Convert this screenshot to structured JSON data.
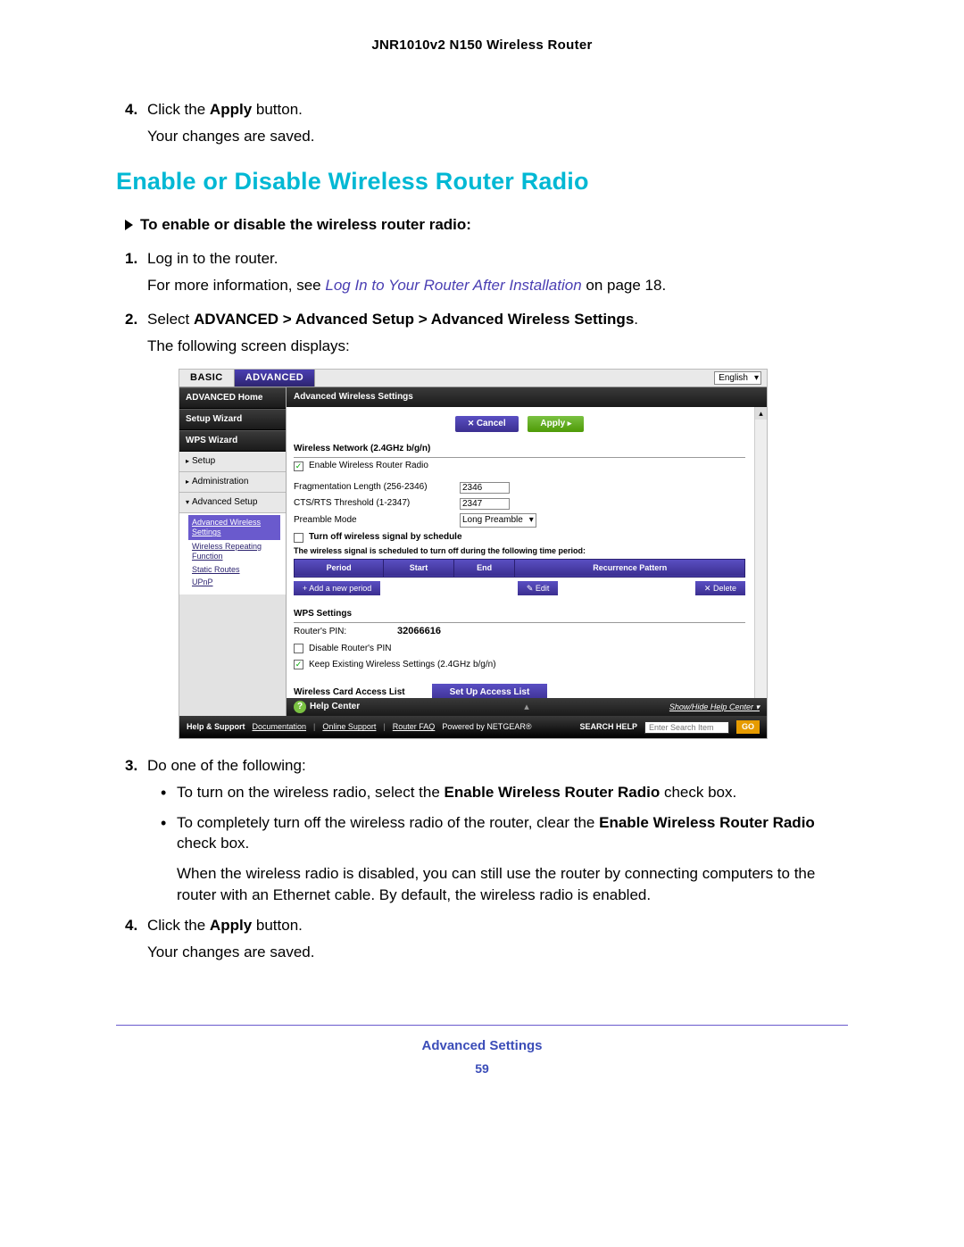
{
  "doc_header": "JNR1010v2 N150 Wireless Router",
  "step4a": {
    "num": "4.",
    "pre": "Click the ",
    "bold": "Apply",
    "post": " button."
  },
  "step4a_sub": "Your changes are saved.",
  "section_title": "Enable or Disable Wireless Router Radio",
  "task_intro": "To enable or disable the wireless router radio:",
  "step1": {
    "num": "1.",
    "text": "Log in to the router."
  },
  "step1_sub_pre": "For more information, see ",
  "step1_link": "Log In to Your Router After Installation",
  "step1_sub_post": " on page 18.",
  "step2": {
    "num": "2.",
    "pre": "Select ",
    "bold": "ADVANCED > Advanced Setup > Advanced Wireless Settings",
    "post": "."
  },
  "step2_sub": "The following screen displays:",
  "step3": {
    "num": "3.",
    "text": "Do one of the following:"
  },
  "bullet1_pre": "To turn on the wireless radio, select the ",
  "bullet1_bold": "Enable Wireless Router Radio",
  "bullet1_post": " check box.",
  "bullet2_pre": "To completely turn off the wireless radio of the router, clear the ",
  "bullet2_bold": "Enable Wireless Router Radio",
  "bullet2_post": " check box.",
  "bullet_note": "When the wireless radio is disabled, you can still use the router by connecting computers to the router with an Ethernet cable. By default, the wireless radio is enabled.",
  "step4b": {
    "num": "4.",
    "pre": "Click the ",
    "bold": "Apply",
    "post": " button."
  },
  "step4b_sub": "Your changes are saved.",
  "footer_label": "Advanced Settings",
  "footer_page": "59",
  "router": {
    "tabs": {
      "basic": "BASIC",
      "advanced": "ADVANCED"
    },
    "lang": "English",
    "sidebar": {
      "home": "ADVANCED Home",
      "setup_wiz": "Setup Wizard",
      "wps_wiz": "WPS Wizard",
      "setup": "Setup",
      "admin": "Administration",
      "adv_setup": "Advanced Setup",
      "sub": {
        "adv_wireless": "Advanced Wireless Settings",
        "repeating": "Wireless Repeating Function",
        "static": "Static Routes",
        "upnp": "UPnP"
      }
    },
    "panel_title": "Advanced Wireless Settings",
    "buttons": {
      "cancel": "Cancel",
      "apply": "Apply"
    },
    "net_label": "Wireless Network (2.4GHz b/g/n)",
    "enable_radio": "Enable Wireless Router Radio",
    "frag_label": "Fragmentation Length (256-2346)",
    "frag_value": "2346",
    "cts_label": "CTS/RTS Threshold (1-2347)",
    "cts_value": "2347",
    "preamble_label": "Preamble Mode",
    "preamble_value": "Long Preamble",
    "schedule_chk": "Turn off wireless signal by schedule",
    "schedule_note": "The wireless signal is scheduled to turn off during the following time period:",
    "tbl": {
      "period": "Period",
      "start": "Start",
      "end": "End",
      "pattern": "Recurrence Pattern"
    },
    "actions": {
      "add": "Add a new period",
      "edit": "Edit",
      "del": "Delete"
    },
    "wps_label": "WPS Settings",
    "pin_label": "Router's PIN:",
    "pin_value": "32066616",
    "disable_pin": "Disable Router's PIN",
    "keep_settings": "Keep Existing Wireless Settings (2.4GHz b/g/n)",
    "access_label": "Wireless Card Access List",
    "access_btn": "Set Up Access List",
    "help_center": "Help Center",
    "show_hide": "Show/Hide Help Center",
    "footer": {
      "help": "Help & Support",
      "doc": "Documentation",
      "online": "Online Support",
      "faq": "Router FAQ",
      "powered": "Powered by NETGEAR®",
      "search_label": "SEARCH HELP",
      "search_placeholder": "Enter Search Item",
      "go": "GO"
    }
  }
}
